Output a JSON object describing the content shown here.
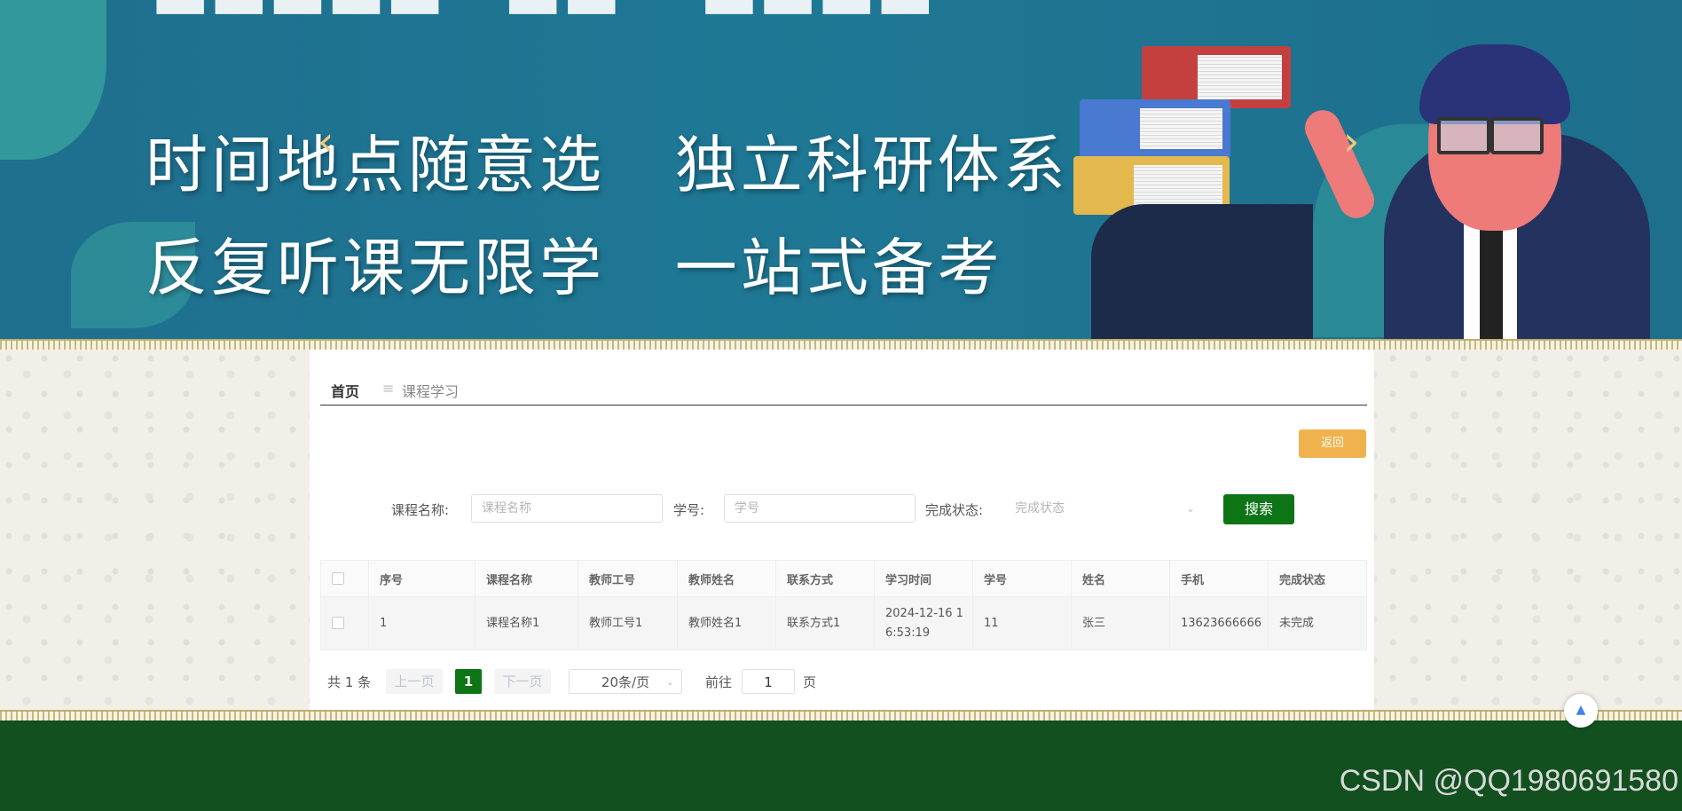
{
  "banner": {
    "line1": "时间地点随意选   独立科研体系",
    "line2": "反复听课无限学   一站式备考",
    "prev_icon": "chevron-left-icon",
    "next_icon": "chevron-right-icon"
  },
  "breadcrumb": {
    "home": "首页",
    "separator": "≡",
    "current": "课程学习"
  },
  "actions": {
    "back": "返回"
  },
  "search": {
    "course_label": "课程名称:",
    "course_placeholder": "课程名称",
    "student_label": "学号:",
    "student_placeholder": "学号",
    "status_label": "完成状态:",
    "status_placeholder": "完成状态",
    "button": "搜索"
  },
  "table": {
    "headers": [
      "序号",
      "课程名称",
      "教师工号",
      "教师姓名",
      "联系方式",
      "学习时间",
      "学号",
      "姓名",
      "手机",
      "完成状态"
    ],
    "rows": [
      [
        "1",
        "课程名称1",
        "教师工号1",
        "教师姓名1",
        "联系方式1",
        "2024-12-16 16:53:19",
        "11",
        "张三",
        "13623666666",
        "未完成"
      ]
    ]
  },
  "pagination": {
    "total": "共 1 条",
    "prev": "上一页",
    "current": "1",
    "next": "下一页",
    "page_size": "20条/页",
    "goto": "前往",
    "goto_value": "1",
    "page_suffix": "页"
  },
  "watermark": "CSDN @QQ1980691580",
  "colors": {
    "accent_green": "#0e7516",
    "footer_green": "#12501f",
    "back_orange": "#efb24c"
  }
}
